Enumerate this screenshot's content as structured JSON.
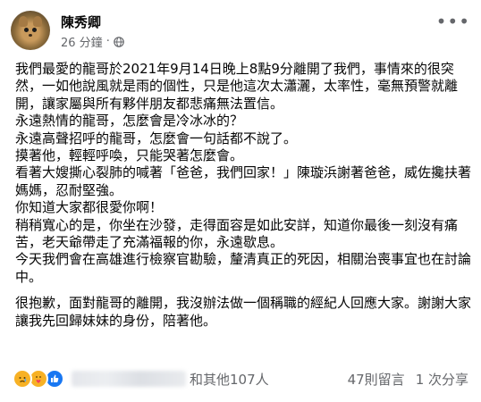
{
  "author": {
    "name": "陳秀卿"
  },
  "meta": {
    "time": "26 分鐘",
    "separator": "·",
    "privacy_icon": "globe-icon"
  },
  "menu_icon": "more-icon",
  "post": {
    "paragraphs": [
      "我們最愛的龍哥於2021年9月14日晚上8點9分離開了我們，事情來的很突然，一如他說風就是雨的個性，只是他這次太瀟灑，太率性，毫無預警就離開，讓家屬與所有夥伴朋友都悲痛無法置信。",
      "永遠熱情的龍哥，怎麼會是冷冰冰的？",
      "永遠高聲招呼的龍哥，怎麼會一句話都不說了。",
      "摸著他，輕輕呼喚，只能哭著怎麼會。",
      "看著大嫂撕心裂肺的喊著「爸爸，我們回家！」陳璇浜謝著爸爸，威佐攙扶著媽媽，忍耐堅強。",
      "你知道大家都很愛你啊！",
      "稍稍寬心的是，你坐在沙發，走得面容是如此安詳，知道你最後一刻沒有痛苦，老天爺帶走了充滿福報的你，永遠歇息。",
      "今天我們會在高雄進行檢察官勘驗，釐清真正的死因，相關治喪事宜也在討論中。",
      "很抱歉，面對龍哥的離開，我沒辦法做一個稱職的經紀人回應大家。謝謝大家讓我先回歸妹妹的身份，陪著他。"
    ]
  },
  "reactions": {
    "icons": [
      "sad-icon",
      "care-icon",
      "like-icon"
    ],
    "others_text": "和其他107人",
    "comments": "47則留言",
    "shares": "1 次分享"
  }
}
